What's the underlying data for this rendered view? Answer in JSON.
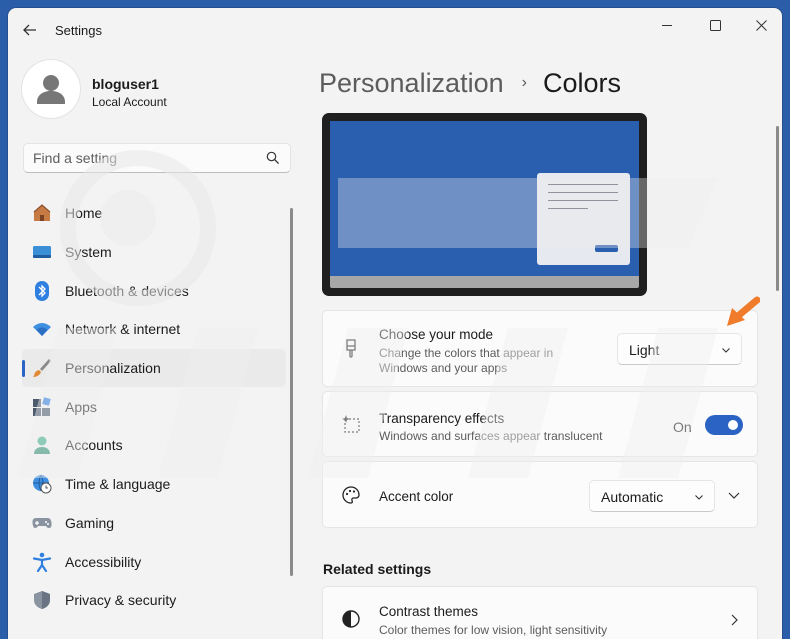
{
  "window": {
    "title": "Settings"
  },
  "profile": {
    "name": "bloguser1",
    "account_type": "Local Account"
  },
  "search": {
    "placeholder": "Find a setting"
  },
  "sidebar": {
    "items": [
      {
        "label": "Home",
        "icon": "home-icon",
        "active": false
      },
      {
        "label": "System",
        "icon": "system-icon",
        "active": false
      },
      {
        "label": "Bluetooth & devices",
        "icon": "bluetooth-icon",
        "active": false
      },
      {
        "label": "Network & internet",
        "icon": "wifi-icon",
        "active": false
      },
      {
        "label": "Personalization",
        "icon": "brush-icon",
        "active": true
      },
      {
        "label": "Apps",
        "icon": "apps-icon",
        "active": false
      },
      {
        "label": "Accounts",
        "icon": "accounts-icon",
        "active": false
      },
      {
        "label": "Time & language",
        "icon": "globe-clock-icon",
        "active": false
      },
      {
        "label": "Gaming",
        "icon": "gamepad-icon",
        "active": false
      },
      {
        "label": "Accessibility",
        "icon": "accessibility-icon",
        "active": false
      },
      {
        "label": "Privacy & security",
        "icon": "shield-icon",
        "active": false
      }
    ]
  },
  "breadcrumb": {
    "parent": "Personalization",
    "separator": "›",
    "current": "Colors"
  },
  "settings": {
    "mode": {
      "title": "Choose your mode",
      "description_line1": "Change the colors that appear in",
      "description_line2": "Windows and your apps",
      "selected": "Light"
    },
    "transparency": {
      "title": "Transparency effects",
      "description": "Windows and surfaces appear translucent",
      "state_label": "On",
      "enabled": true
    },
    "accent": {
      "title": "Accent color",
      "selected": "Automatic"
    }
  },
  "related": {
    "heading": "Related settings",
    "items": [
      {
        "title": "Contrast themes",
        "description": "Color themes for low vision, light sensitivity"
      }
    ]
  },
  "colors": {
    "accent": "#2b63c4",
    "desktop_background": "#2b5ea8",
    "annotation_arrow": "#f07c2b"
  }
}
